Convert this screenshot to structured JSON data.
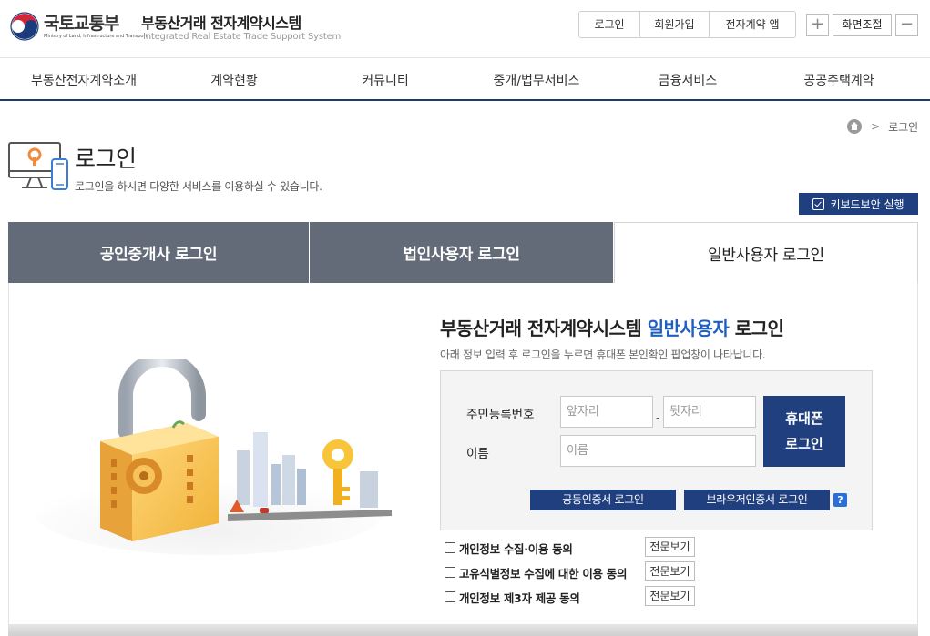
{
  "header": {
    "ministry_name": "국토교통부",
    "ministry_name_en": "Ministry of Land, Infrastructure and Transport",
    "system_title": "부동산거래 전자계약시스템",
    "system_title_en": "Integrated Real Estate Trade Support System",
    "top_links": [
      "로그인",
      "회원가입",
      "전자계약 앱"
    ],
    "zoom_plus": "+",
    "zoom_label": "화면조절",
    "zoom_minus": "−"
  },
  "nav": {
    "items": [
      "부동산전자계약소개",
      "계약현황",
      "커뮤니티",
      "중개/법무서비스",
      "금융서비스",
      "공공주택계약"
    ]
  },
  "breadcrumb": {
    "separator": ">",
    "current": "로그인"
  },
  "page": {
    "title": "로그인",
    "description": "로그인을 하시면 다양한 서비스를 이용하실 수 있습니다.",
    "keyboard_security_button": "키보드보안 실행"
  },
  "tabs": [
    {
      "label": "공인중개사 로그인",
      "active": false
    },
    {
      "label": "법인사용자 로그인",
      "active": false
    },
    {
      "label": "일반사용자 로그인",
      "active": true
    }
  ],
  "login": {
    "heading_prefix": "부동산거래 전자계약시스템",
    "heading_highlight": "일반사용자",
    "heading_suffix": "로그인",
    "subtext": "아래 정보 입력 후 로그인을 누르면 휴대폰 본인확인 팝업창이 나타납니다.",
    "rrn_label": "주민등록번호",
    "rrn_front_placeholder": "앞자리",
    "rrn_dash": "-",
    "rrn_back_placeholder": "뒷자리",
    "name_label": "이름",
    "name_placeholder": "이름",
    "phone_login_line1": "휴대폰",
    "phone_login_line2": "로그인",
    "public_cert_login": "공동인증서 로그인",
    "browser_cert_login": "브라우저인증서 로그인",
    "help": "?"
  },
  "agreements": [
    {
      "label": "개인정보 수집·이용 동의",
      "view": "전문보기",
      "checked": false
    },
    {
      "label": "고유식별정보 수집에 대한 이용 동의",
      "view": "전문보기",
      "checked": false
    },
    {
      "label": "개인정보 제3자 제공 동의",
      "view": "전문보기",
      "checked": false
    }
  ],
  "colors": {
    "navy": "#1f3f7f",
    "tab_inactive": "#636b78",
    "highlight_blue": "#1f5fbf",
    "nav_border": "#1c3b6f"
  }
}
